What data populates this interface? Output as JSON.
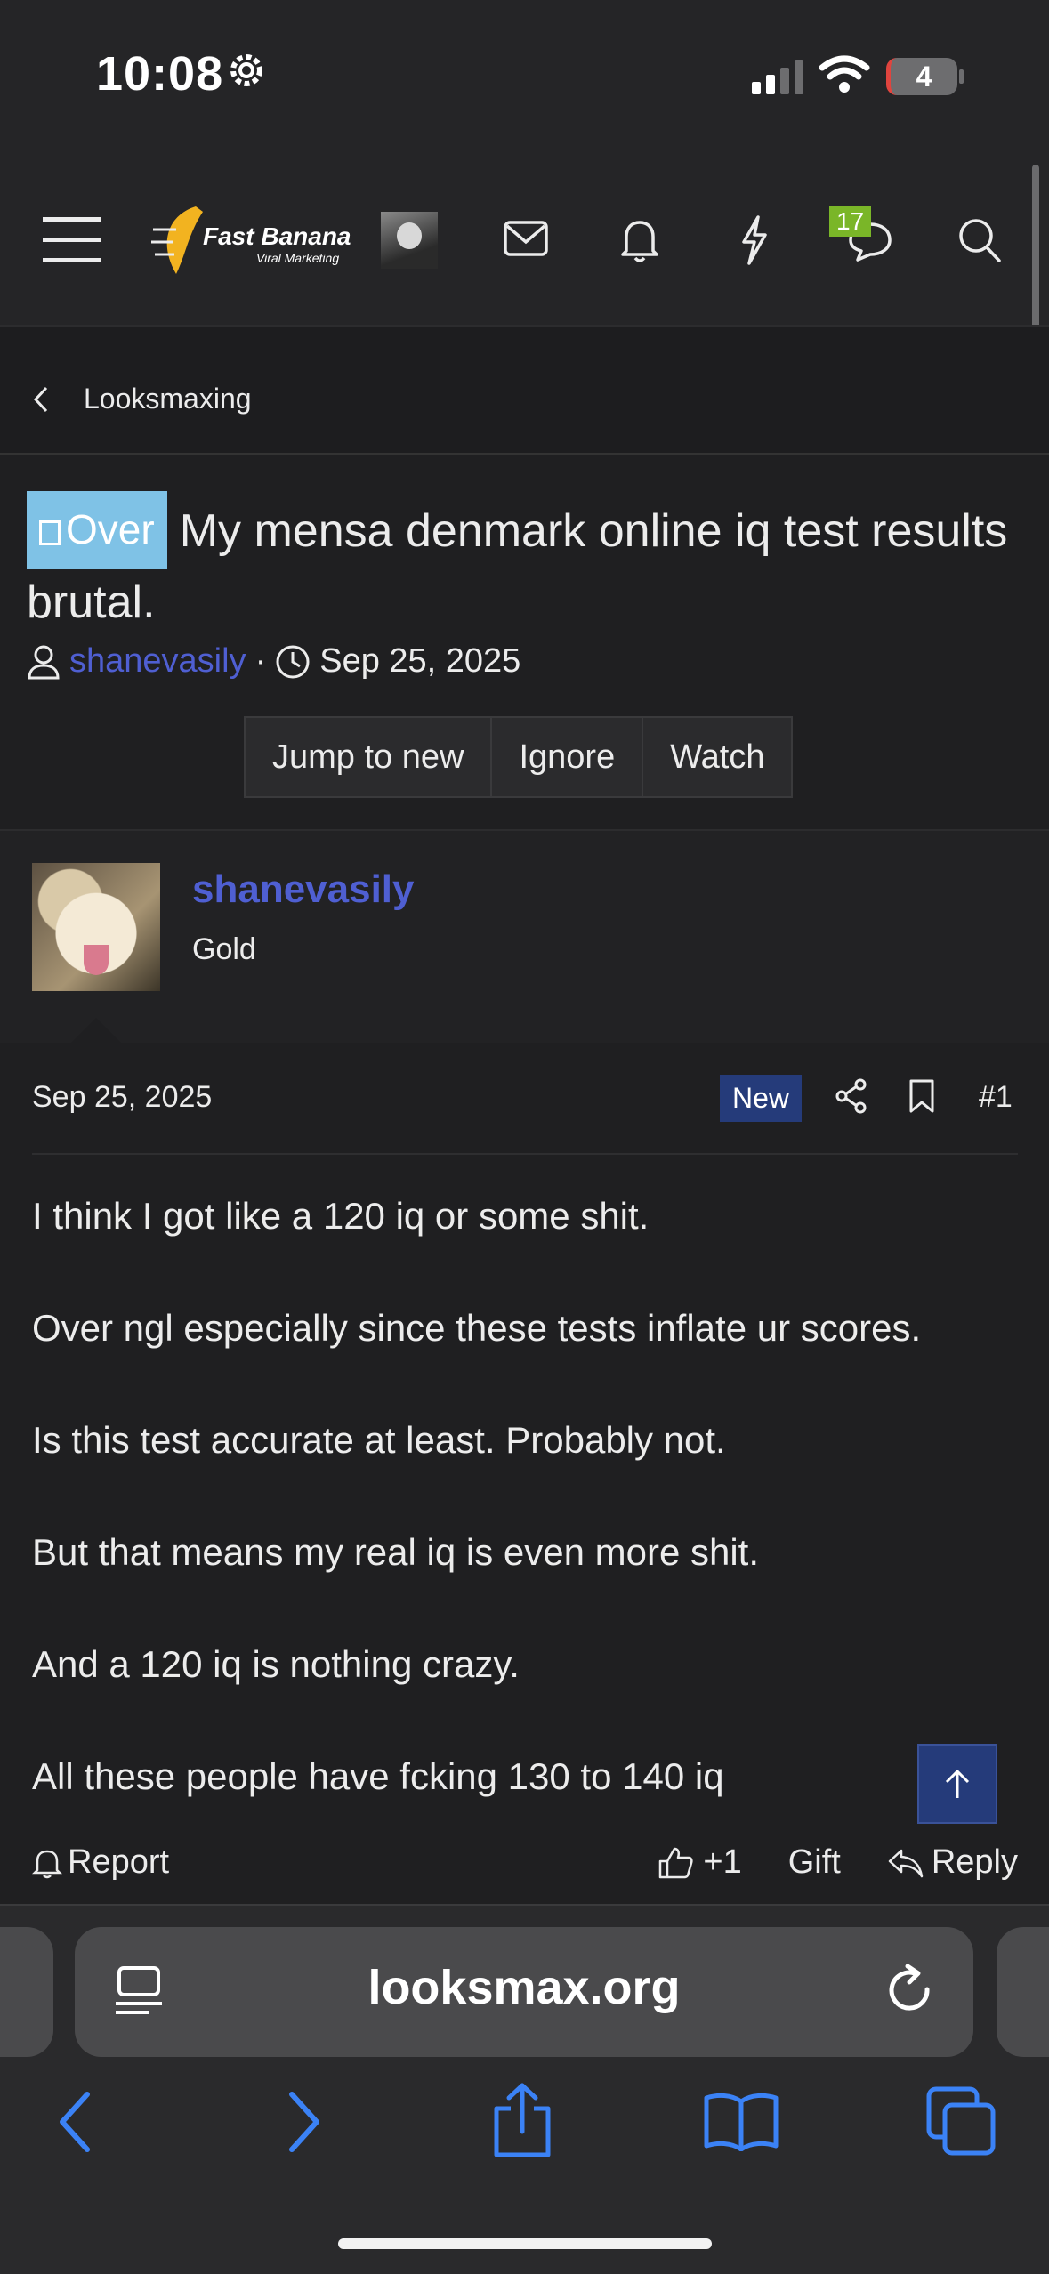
{
  "status_bar": {
    "time": "10:08",
    "battery": "4"
  },
  "header": {
    "logo_text": "Fast Banana",
    "logo_subtext": "Viral Marketing",
    "chat_badge": "17"
  },
  "breadcrumb": {
    "label": "Looksmaxing"
  },
  "thread": {
    "prefix": "Over",
    "title": "My mensa denmark online iq test results brutal.",
    "author": "shanevasily",
    "meta_sep": "·",
    "date": "Sep 25, 2025",
    "buttons": {
      "jump": "Jump to new",
      "ignore": "Ignore",
      "watch": "Watch"
    }
  },
  "post": {
    "username": "shanevasily",
    "user_title": "Gold",
    "date": "Sep 25, 2025",
    "new_label": "New",
    "number": "#1",
    "lines": [
      "I think I got like a 120 iq or some shit.",
      "Over ngl especially since these tests inflate ur scores.",
      "Is this test accurate at least. Probably not.",
      "But that means my real iq is even more shit.",
      "And a 120 iq is nothing crazy.",
      "All these people have fcking 130 to 140 iq"
    ],
    "actions": {
      "report": "Report",
      "like_count": "+1",
      "gift": "Gift",
      "reply": "Reply"
    }
  },
  "browser": {
    "url": "looksmax.org"
  },
  "colors": {
    "accent": "#4f5fd2",
    "prefix": "#7fc2e6",
    "new_badge": "#253b7a",
    "chat_badge": "#7ab628",
    "browser_icons": "#3b82f6"
  }
}
